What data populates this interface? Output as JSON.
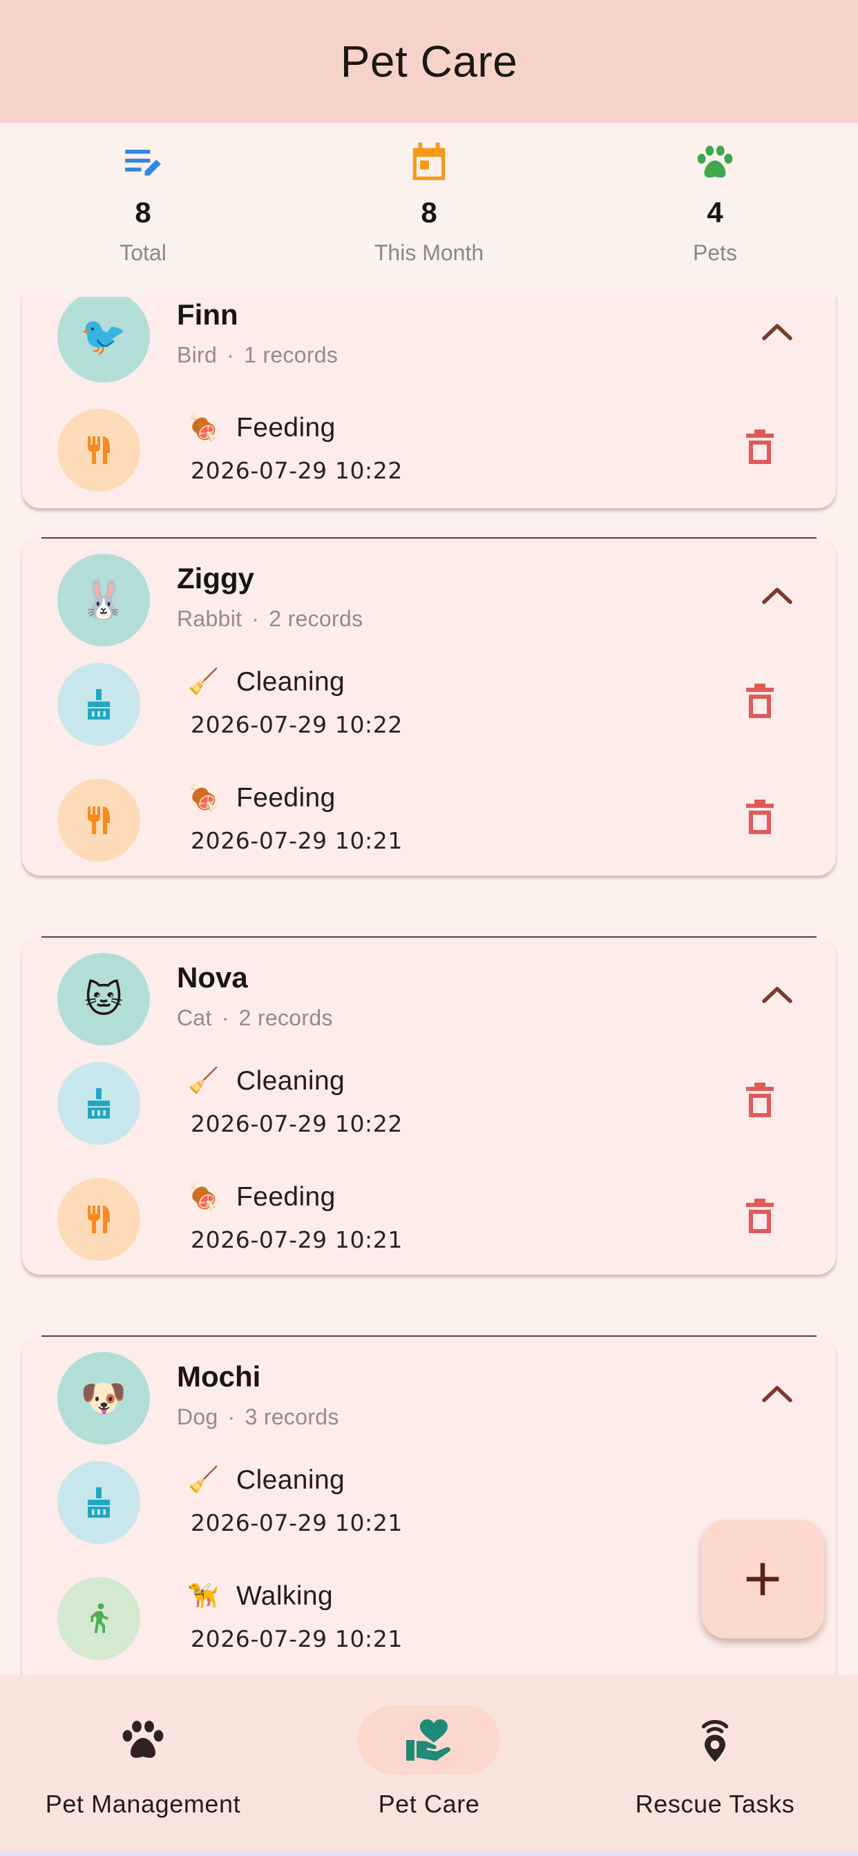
{
  "app": {
    "title": "Pet Care"
  },
  "stats": [
    {
      "value": "8",
      "label": "Total",
      "icon": "edit-note-icon",
      "color": "#2f86e6"
    },
    {
      "value": "8",
      "label": "This Month",
      "icon": "calendar-icon",
      "color": "#f49a18"
    },
    {
      "value": "4",
      "label": "Pets",
      "icon": "paw-icon",
      "color": "#3fa84a"
    }
  ],
  "pets": [
    {
      "name": "Finn",
      "species": "Bird",
      "records_label": "1 records",
      "avatar": "🐦",
      "records": [
        {
          "emoji": "🍖",
          "type": "Feeding",
          "datetime": "2026-07-29 10:22",
          "icon": "utensils-icon"
        }
      ]
    },
    {
      "name": "Ziggy",
      "species": "Rabbit",
      "records_label": "2 records",
      "avatar": "🐰",
      "records": [
        {
          "emoji": "🧹",
          "type": "Cleaning",
          "datetime": "2026-07-29 10:22",
          "icon": "brush-icon"
        },
        {
          "emoji": "🍖",
          "type": "Feeding",
          "datetime": "2026-07-29 10:21",
          "icon": "utensils-icon"
        }
      ]
    },
    {
      "name": "Nova",
      "species": "Cat",
      "records_label": "2 records",
      "avatar": "🐱",
      "records": [
        {
          "emoji": "🧹",
          "type": "Cleaning",
          "datetime": "2026-07-29 10:22",
          "icon": "brush-icon"
        },
        {
          "emoji": "🍖",
          "type": "Feeding",
          "datetime": "2026-07-29 10:21",
          "icon": "utensils-icon"
        }
      ]
    },
    {
      "name": "Mochi",
      "species": "Dog",
      "records_label": "3 records",
      "avatar": "🐶",
      "records": [
        {
          "emoji": "🧹",
          "type": "Cleaning",
          "datetime": "2026-07-29 10:21",
          "icon": "brush-icon"
        },
        {
          "emoji": "🦮",
          "type": "Walking",
          "datetime": "2026-07-29 10:21",
          "icon": "walk-icon"
        }
      ]
    }
  ],
  "meta_separator": "·",
  "fab": {
    "icon": "plus-icon"
  },
  "nav": [
    {
      "label": "Pet Management",
      "icon": "paw-icon",
      "active": false
    },
    {
      "label": "Pet Care",
      "icon": "volunteer-heart-icon",
      "active": true
    },
    {
      "label": "Rescue Tasks",
      "icon": "location-signal-icon",
      "active": false
    }
  ],
  "colors": {
    "appbar": "#f6d3c9",
    "background": "#fdf1ee",
    "card": "#fdecea",
    "delete": "#e05a5a",
    "chevron": "#7a3a2c",
    "nav_active": "#fcd7cd",
    "care_icon": "#1f8a78"
  }
}
